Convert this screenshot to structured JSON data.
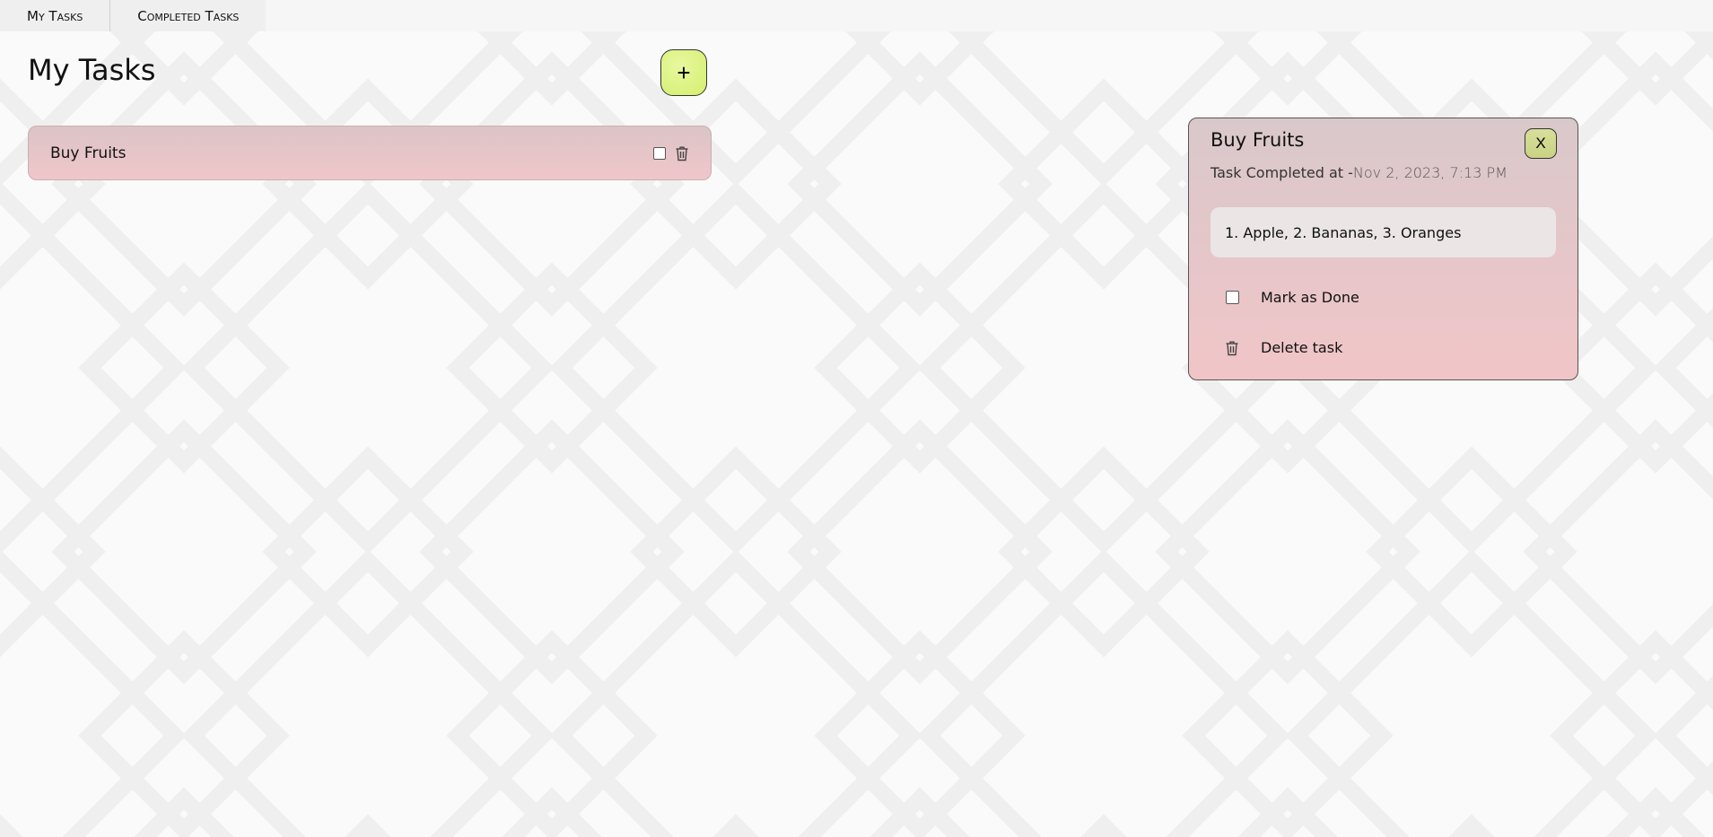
{
  "tabs": [
    {
      "label": "My Tasks"
    },
    {
      "label": "Completed Tasks"
    }
  ],
  "page": {
    "title": "My Tasks",
    "add_button_label": "+"
  },
  "tasks": [
    {
      "name": "Buy Fruits",
      "checked": false
    }
  ],
  "detail": {
    "title": "Buy Fruits",
    "close_label": "X",
    "completed_prefix": "Task Completed at -",
    "completed_date": "Nov 2, 2023, 7:13 PM",
    "description": "1. Apple, 2. Bananas, 3. Oranges",
    "mark_done_label": "Mark as Done",
    "mark_done_checked": false,
    "delete_label": "Delete task"
  },
  "colors": {
    "accent": "#d3ef6e",
    "card": "#f0c6ca",
    "background": "#fafafa"
  },
  "icons": {
    "task_checkbox": "checkbox-icon",
    "task_delete": "trash-icon",
    "add": "plus-icon",
    "close": "close-icon"
  }
}
